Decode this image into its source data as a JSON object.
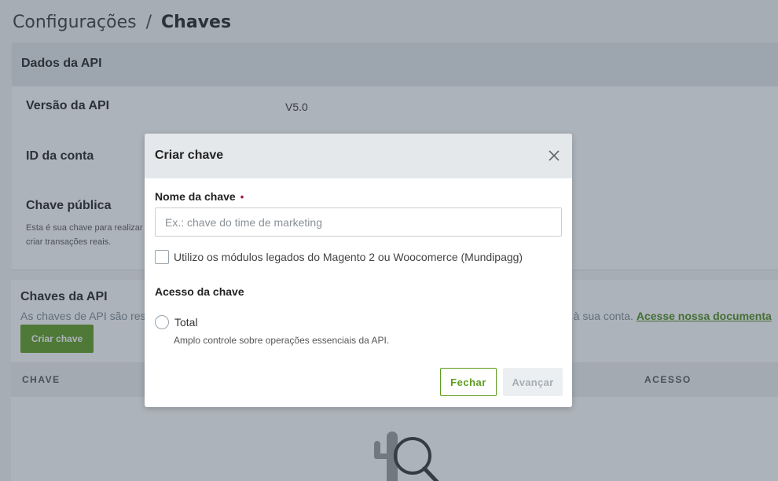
{
  "breadcrumb": {
    "parent": "Configurações",
    "separator": "/",
    "current": "Chaves"
  },
  "api_card": {
    "title": "Dados da API",
    "rows": [
      {
        "label": "Versão da API",
        "value": "V5.0"
      },
      {
        "label": "ID da conta",
        "value": ""
      },
      {
        "label": "Chave pública",
        "value": "",
        "help": "Esta é sua chave para realizar criar transações reais."
      }
    ]
  },
  "keys_card": {
    "title": "Chaves da API",
    "description_left": "As chaves de API são res",
    "description_right": "e à sua conta.",
    "doc_link": "Acesse nossa documenta",
    "create_button": "Criar chave",
    "columns": [
      "CHAVE",
      "ACESSO"
    ]
  },
  "modal": {
    "title": "Criar chave",
    "name_label": "Nome da chave",
    "required_mark": "•",
    "name_placeholder": "Ex.: chave do time de marketing",
    "name_value": "",
    "legacy_checkbox_label": "Utilizo os módulos legados do Magento 2 ou Woocomerce (Mundipagg)",
    "legacy_checked": false,
    "access_title": "Acesso da chave",
    "access_options": [
      {
        "label": "Total",
        "help": "Amplo controle sobre operações essenciais da API.",
        "selected": false
      }
    ],
    "close_button": "Fechar",
    "next_button": "Avançar",
    "next_enabled": false
  },
  "colors": {
    "brand_green": "#5e9b1e",
    "header_gray": "#e4e8eb",
    "required_red": "#a3193c"
  }
}
